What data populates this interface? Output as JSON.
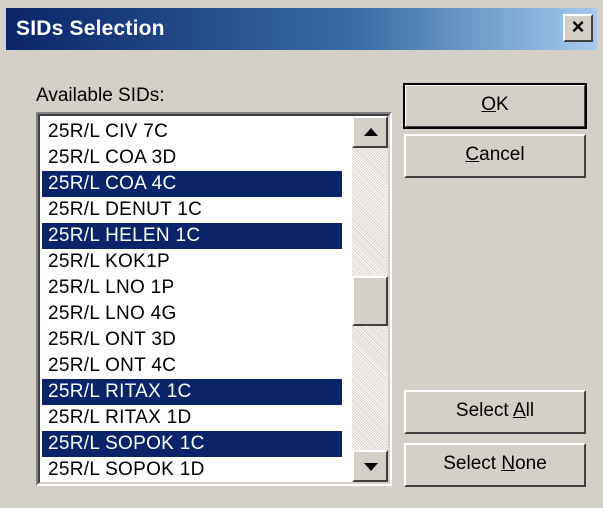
{
  "window": {
    "title": "SIDs Selection",
    "close_label": "×"
  },
  "list": {
    "label": "Available SIDs:",
    "items": [
      {
        "text": "25R/L CIV 7C",
        "selected": false
      },
      {
        "text": "25R/L COA 3D",
        "selected": false
      },
      {
        "text": "25R/L COA 4C",
        "selected": true
      },
      {
        "text": "25R/L DENUT 1C",
        "selected": false
      },
      {
        "text": "25R/L HELEN 1C",
        "selected": true
      },
      {
        "text": "25R/L KOK1P",
        "selected": false
      },
      {
        "text": "25R/L LNO 1P",
        "selected": false
      },
      {
        "text": "25R/L LNO 4G",
        "selected": false
      },
      {
        "text": "25R/L ONT 3D",
        "selected": false
      },
      {
        "text": "25R/L ONT 4C",
        "selected": false
      },
      {
        "text": "25R/L RITAX 1C",
        "selected": true
      },
      {
        "text": "25R/L RITAX 1D",
        "selected": false
      },
      {
        "text": "25R/L SOPOK 1C",
        "selected": true
      },
      {
        "text": "25R/L SOPOK 1D",
        "selected": false
      }
    ]
  },
  "buttons": {
    "ok_mn": "O",
    "ok_rest": "K",
    "cancel_mn": "C",
    "cancel_rest": "ancel",
    "select_all_pre": "Select ",
    "select_all_mn": "A",
    "select_all_post": "ll",
    "select_none_pre": "Select ",
    "select_none_mn": "N",
    "select_none_post": "one"
  },
  "colors": {
    "selection": "#0a246a",
    "dialog_bg": "#d4d0c8"
  }
}
